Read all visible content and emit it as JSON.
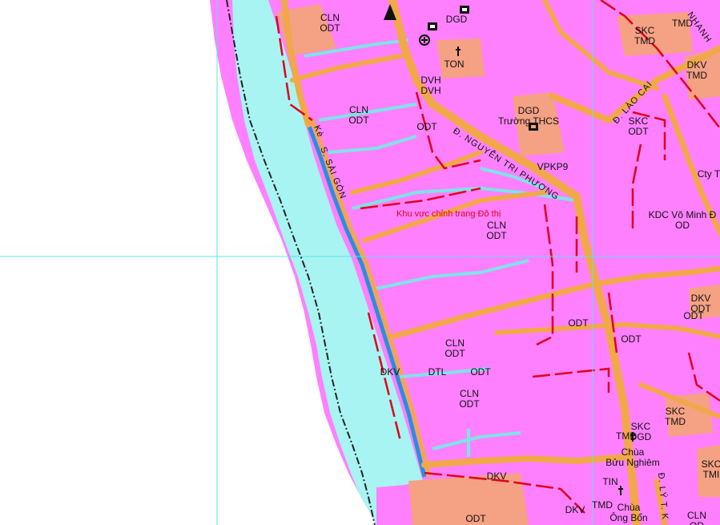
{
  "colors": {
    "land": "#ff80ff",
    "water": "#a8f4f2",
    "canal": "#7fe3e6",
    "road": "#f0a848",
    "road_edge": "#8c5a2a",
    "special": "#f4a184",
    "boundary": "#e0001b",
    "grid": "#54e4ef",
    "admin_line": "#222222"
  },
  "river_label": "S. SÀI GÒN",
  "river_label_prefix": "Kè",
  "roads": {
    "nguyen_tri_phuong": "Đ. NGUYỄN TRI PHƯƠNG",
    "lao_cai": "Đ. LÀO CAI",
    "ly_thuong": "Đ. LÝ T. K",
    "nhanh": "NHANH"
  },
  "area_note": "Khu vực chỉnh trang Đô thị",
  "labels": [
    {
      "id": "cln-1",
      "line1": "CLN",
      "line2": "ODT"
    },
    {
      "id": "dgd-top",
      "line1": "DGD",
      "line2": ""
    },
    {
      "id": "skc-1",
      "line1": "SKC",
      "line2": "TMD"
    },
    {
      "id": "tmd-top",
      "line1": "TMD",
      "line2": ""
    },
    {
      "id": "ton",
      "line1": "TON",
      "line2": ""
    },
    {
      "id": "dvh",
      "line1": "DVH",
      "line2": "DVH"
    },
    {
      "id": "dkv-right",
      "line1": "DKV",
      "line2": "TMD"
    },
    {
      "id": "cln-2",
      "line1": "CLN",
      "line2": "ODT"
    },
    {
      "id": "dgd-thcs",
      "line1": "DGD",
      "line2": "Trường THCS"
    },
    {
      "id": "skc-2",
      "line1": "SKC",
      "line2": "ODT"
    },
    {
      "id": "odt-a",
      "line1": "ODT",
      "line2": ""
    },
    {
      "id": "vpkp9",
      "line1": "VPKP9",
      "line2": ""
    },
    {
      "id": "cty",
      "line1": "Cty T",
      "line2": ""
    },
    {
      "id": "cln-3",
      "line1": "CLN",
      "line2": "ODT"
    },
    {
      "id": "kdc",
      "line1": "KDC Võ Minh Đ",
      "line2": "OD"
    },
    {
      "id": "dkv-2",
      "line1": "DKV",
      "line2": "ODT"
    },
    {
      "id": "odt-b",
      "line1": "ODT",
      "line2": ""
    },
    {
      "id": "cln-4",
      "line1": "CLN",
      "line2": "ODT"
    },
    {
      "id": "odt-c",
      "line1": "ODT",
      "line2": ""
    },
    {
      "id": "dkv-3",
      "line1": "DKV",
      "line2": ""
    },
    {
      "id": "dtl",
      "line1": "DTL",
      "line2": ""
    },
    {
      "id": "odt-d",
      "line1": "ODT",
      "line2": ""
    },
    {
      "id": "odt-e",
      "line1": "ODT",
      "line2": ""
    },
    {
      "id": "cln-5",
      "line1": "CLN",
      "line2": "ODT"
    },
    {
      "id": "skc-3",
      "line1": "SKC",
      "line2": "TMD"
    },
    {
      "id": "skc-dgd",
      "line1": "SKC",
      "line2": "DGD"
    },
    {
      "id": "tmd-mid",
      "line1": "TMD",
      "line2": ""
    },
    {
      "id": "chua-bn",
      "line1": "Chùa",
      "line2": "Bửu Nghiêm"
    },
    {
      "id": "dkv-bottom",
      "line1": "DKV",
      "line2": ""
    },
    {
      "id": "tin",
      "line1": "TIN",
      "line2": ""
    },
    {
      "id": "skc-right",
      "line1": "SKC",
      "line2": "TMI"
    },
    {
      "id": "odt-bottom",
      "line1": "ODT",
      "line2": ""
    },
    {
      "id": "dkv-b2",
      "line1": "DKV",
      "line2": ""
    },
    {
      "id": "tmd-b",
      "line1": "TMD",
      "line2": ""
    },
    {
      "id": "chua-ob",
      "line1": "Chùa",
      "line2": "Ông Bổn"
    },
    {
      "id": "cln-br",
      "line1": "CLN",
      "line2": "OD"
    }
  ]
}
